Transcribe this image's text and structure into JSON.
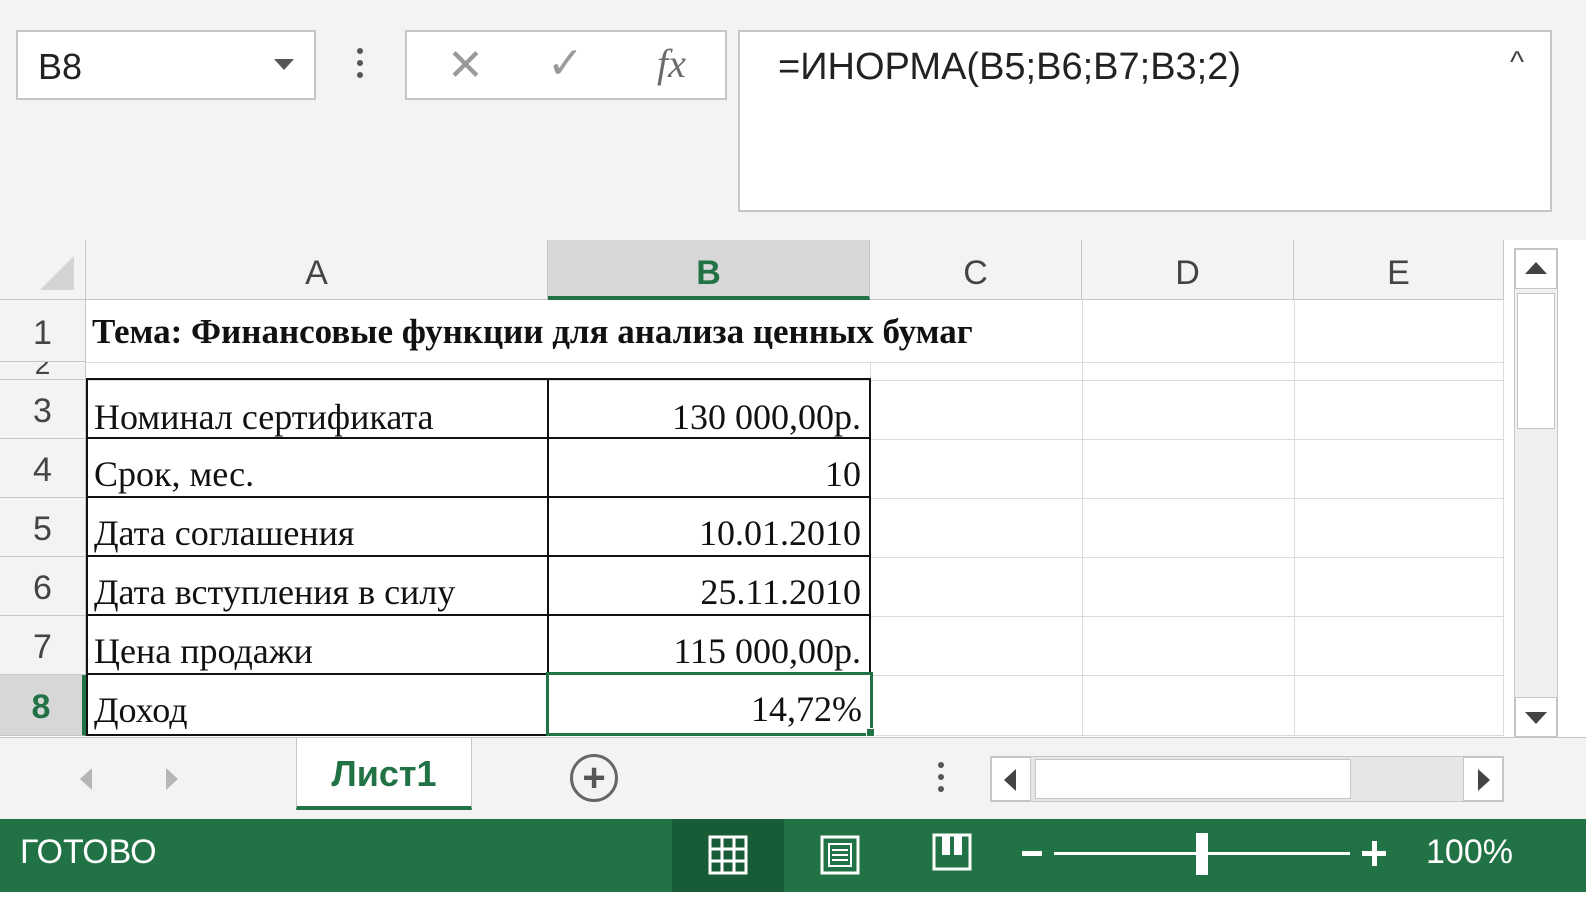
{
  "name_box": {
    "value": "B8"
  },
  "formula_bar": {
    "cancel_icon": "✕",
    "enter_icon": "✓",
    "fx_label": "fx",
    "formula": "=ИНОРМА(B5;B6;B7;B3;2)",
    "collapse_icon": "^"
  },
  "columns": [
    "A",
    "B",
    "C",
    "D",
    "E"
  ],
  "rows": [
    "1",
    "2",
    "3",
    "4",
    "5",
    "6",
    "7",
    "8"
  ],
  "selected_column": "B",
  "selected_row": "8",
  "cells": {
    "a1": "Тема: Финансовые функции для анализа ценных бумаг",
    "a3": "Номинал сертификата",
    "b3": "130 000,00р.",
    "a4": "Срок, мес.",
    "b4": "10",
    "a5": "Дата соглашения",
    "b5": "10.01.2010",
    "a6": "Дата вступления в силу",
    "b6": "25.11.2010",
    "a7": "Цена продажи",
    "b7": "115 000,00р.",
    "a8": "Доход",
    "b8": "14,72%"
  },
  "sheets": [
    {
      "name": "Лист1",
      "active": true
    }
  ],
  "status": {
    "mode": "ГОТОВО",
    "zoom": "100%"
  },
  "accent_color": "#217346"
}
